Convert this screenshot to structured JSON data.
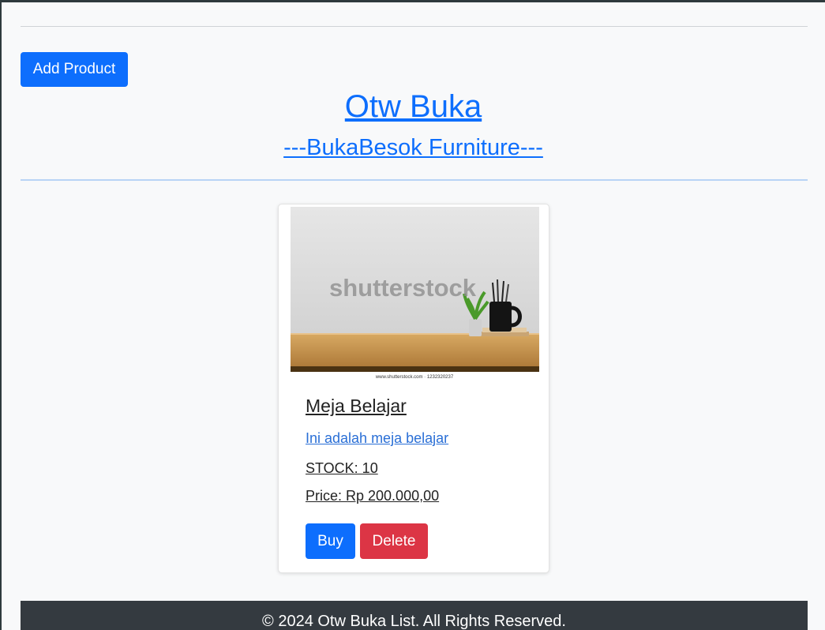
{
  "toolbar": {
    "add_product_label": "Add Product"
  },
  "header": {
    "title": "Otw Buka",
    "subtitle": "---BukaBesok Furniture---"
  },
  "products": [
    {
      "name": "Meja Belajar",
      "description": "Ini adalah meja belajar",
      "stock": "STOCK: 10",
      "price": "Price: Rp 200.000,00",
      "image_watermark": "shutterstock",
      "image_caption": "www.shutterstock.com · 1232320237",
      "buy_label": "Buy",
      "delete_label": "Delete"
    }
  ],
  "footer": {
    "text": "© 2024 Otw Buka List. All Rights Reserved."
  },
  "colors": {
    "primary": "#0d6efd",
    "danger": "#dc3545",
    "footer_bg": "#343a40",
    "page_bg": "#f8f9fa"
  }
}
